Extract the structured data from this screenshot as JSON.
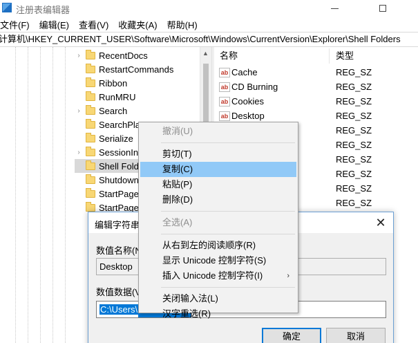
{
  "window": {
    "title": "注册表编辑器",
    "minimize_glyph": "",
    "maximize_glyph": ""
  },
  "menu": [
    "文件(F)",
    "编辑(E)",
    "查看(V)",
    "收藏夹(A)",
    "帮助(H)"
  ],
  "address": "计算机\\HKEY_CURRENT_USER\\Software\\Microsoft\\Windows\\CurrentVersion\\Explorer\\Shell Folders",
  "tree": {
    "items": [
      {
        "label": "RecentDocs",
        "expandable": true
      },
      {
        "label": "RestartCommands",
        "expandable": false
      },
      {
        "label": "Ribbon",
        "expandable": false
      },
      {
        "label": "RunMRU",
        "expandable": false
      },
      {
        "label": "Search",
        "expandable": true
      },
      {
        "label": "SearchPla",
        "expandable": false
      },
      {
        "label": "Serialize",
        "expandable": false
      },
      {
        "label": "SessionIn",
        "expandable": true
      },
      {
        "label": "Shell Fold",
        "expandable": false,
        "selected": true
      },
      {
        "label": "Shutdown",
        "expandable": false
      },
      {
        "label": "StartPage",
        "expandable": false
      },
      {
        "label": "StartPage",
        "expandable": false
      }
    ],
    "scroll_up_glyph": "▲"
  },
  "values": {
    "headers": {
      "name": "名称",
      "type": "类型"
    },
    "rows": [
      {
        "name": "Cache",
        "type": "REG_SZ",
        "icon": "ab"
      },
      {
        "name": "CD Burning",
        "type": "REG_SZ",
        "icon": "ab"
      },
      {
        "name": "Cookies",
        "type": "REG_SZ",
        "icon": "ab"
      },
      {
        "name": "Desktop",
        "type": "REG_SZ",
        "icon": "ab"
      },
      {
        "name": "",
        "type": "REG_SZ",
        "icon": ""
      },
      {
        "name": "",
        "type": "REG_SZ",
        "icon": ""
      },
      {
        "name": "",
        "type": "REG_SZ",
        "icon": ""
      },
      {
        "name": "",
        "type": "REG_SZ",
        "icon": ""
      },
      {
        "name": "",
        "type": "REG_SZ",
        "icon": ""
      },
      {
        "name": "",
        "type": "REG_SZ",
        "icon": ""
      }
    ]
  },
  "dialog": {
    "title": "编辑字符串",
    "name_label": "数值名称(N",
    "name_value": "Desktop",
    "data_label": "数值数据(V",
    "data_value": "C:\\Users\\",
    "ok_label": "确定",
    "cancel_label": "取消",
    "close_glyph": "✕"
  },
  "context_menu": {
    "items": [
      {
        "label": "撤消(U)",
        "disabled": true
      },
      {
        "separator": true
      },
      {
        "label": "剪切(T)"
      },
      {
        "label": "复制(C)",
        "highlighted": true
      },
      {
        "label": "粘贴(P)"
      },
      {
        "label": "删除(D)"
      },
      {
        "separator": true
      },
      {
        "label": "全选(A)",
        "disabled": true
      },
      {
        "separator": true
      },
      {
        "label": "从右到左的阅读顺序(R)"
      },
      {
        "label": "显示 Unicode 控制字符(S)"
      },
      {
        "label": "插入 Unicode 控制字符(I)",
        "submenu": true
      },
      {
        "separator": true
      },
      {
        "label": "关闭输入法(L)"
      },
      {
        "label": "汉字重选(R)"
      }
    ],
    "submenu_glyph": "›"
  },
  "colors": {
    "selection": "#0078d7",
    "menu_highlight": "#91c9f7",
    "folder": "#f8d775",
    "dialog_border": "#6a9fd4"
  }
}
